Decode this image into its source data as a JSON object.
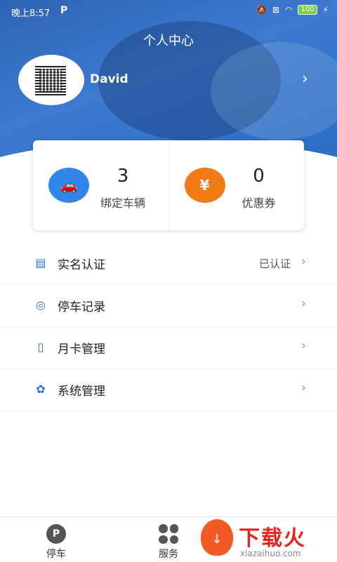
{
  "status_bar": {
    "time": "晚上8:57",
    "app_badge": "P",
    "battery": "100"
  },
  "header": {
    "title": "个人中心",
    "username": "David"
  },
  "stats": [
    {
      "value": "3",
      "label": "绑定车辆",
      "icon": "car-link-icon",
      "color": "#2f86e6"
    },
    {
      "value": "0",
      "label": "优惠券",
      "icon": "coupon-icon",
      "color": "#f07a14"
    }
  ],
  "menu": [
    {
      "label": "实名认证",
      "value": "已认证",
      "icon": "id-card-icon"
    },
    {
      "label": "停车记录",
      "value": "",
      "icon": "parking-record-icon"
    },
    {
      "label": "月卡管理",
      "value": "",
      "icon": "month-card-icon"
    },
    {
      "label": "系统管理",
      "value": "",
      "icon": "system-settings-icon"
    }
  ],
  "tabbar": [
    {
      "label": "停车",
      "icon": "parking-icon"
    },
    {
      "label": "服务",
      "icon": "services-grid-icon"
    }
  ],
  "watermark": {
    "cn": "下载火",
    "en": "xiazaihuo.com"
  }
}
